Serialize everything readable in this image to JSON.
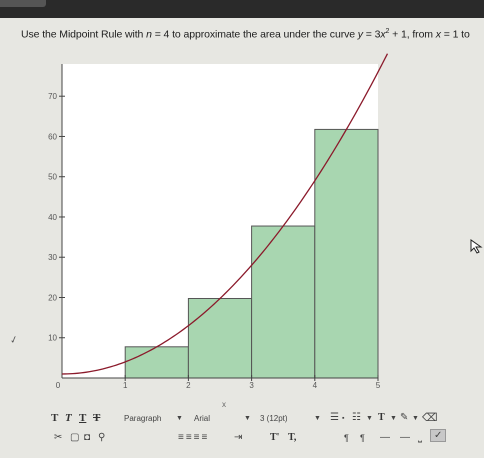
{
  "question": {
    "prompt_prefix": "Use the Midpoint Rule with ",
    "n_var": "n",
    "prompt_n": " = 4 to approximate the area under the curve ",
    "y_var": "y",
    "prompt_eq": " = 3",
    "x_var1": "x",
    "exponent": "2",
    "prompt_mid": " + 1, from ",
    "x_var2": "x",
    "prompt_tail": " = 1 to"
  },
  "chart_data": {
    "type": "bar",
    "title": "",
    "xlabel": "",
    "ylabel": "",
    "xlim": [
      0,
      5
    ],
    "ylim": [
      0,
      78
    ],
    "x_ticks": [
      "0",
      "1",
      "2",
      "3",
      "4",
      "5"
    ],
    "y_ticks": [
      "10",
      "20",
      "30",
      "40",
      "50",
      "60",
      "70"
    ],
    "rectangles": [
      {
        "x_from": 1,
        "x_to": 2,
        "height": 7.75
      },
      {
        "x_from": 2,
        "x_to": 3,
        "height": 19.75
      },
      {
        "x_from": 3,
        "x_to": 4,
        "height": 37.75
      },
      {
        "x_from": 4,
        "x_to": 5,
        "height": 61.75
      }
    ],
    "curve": {
      "equation": "y = 3x^2 + 1",
      "x_from": 0,
      "x_to": 5.15
    },
    "grid": false,
    "colors": {
      "bar_fill": "#a8d6b0",
      "bar_stroke": "#555555",
      "curve": "#8b1a2b"
    }
  },
  "editor_toolbar": {
    "font_style_buttons": [
      "T",
      "T",
      "T",
      "T"
    ],
    "paragraph_select": "Paragraph",
    "font_select": "Arial",
    "size_select": "3 (12pt)",
    "superscript_button": "T'",
    "subscript_button": "T,",
    "x_mark": "x"
  }
}
